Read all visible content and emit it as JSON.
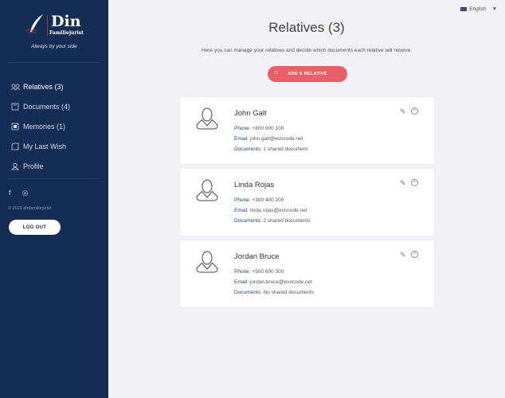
{
  "sidebar": {
    "logo": {
      "name": "Din",
      "subname": "Familiejurist"
    },
    "tagline": "Always by your side",
    "nav": [
      {
        "label": "Relatives (3)",
        "icon": "relatives-icon",
        "active": true
      },
      {
        "label": "Documents (4)",
        "icon": "documents-icon"
      },
      {
        "label": "Memories (1)",
        "icon": "memories-icon"
      },
      {
        "label": "My Last Wish",
        "icon": "last-wish-icon"
      },
      {
        "label": "Profile",
        "icon": "profile-icon"
      }
    ],
    "social": {
      "facebook": "f",
      "instagram": "◎"
    },
    "copyright": "© 2023 dinfamiliejurist",
    "logout": "LOG OUT"
  },
  "header": {
    "language": "English"
  },
  "main": {
    "title": "Relatives (3)",
    "intro": "Here you can manage your relatives and decide which documents each relative will receive.",
    "add_button": "ADD A RELATIVE",
    "labels": {
      "phone": "Phone:",
      "email": "Email:",
      "documents": "Documents:"
    },
    "relatives": [
      {
        "name": "John Galt",
        "phone": "+800 900 100",
        "email": "john.galt@evocode.net",
        "documents": "1 shared document"
      },
      {
        "name": "Linda Rojas",
        "phone": "+300 400 200",
        "email": "linda.rojas@evocode.net",
        "documents": "2 shared documents"
      },
      {
        "name": "Jordan Bruce",
        "phone": "+500 600 300",
        "email": "jordan.bruce@evocode.net",
        "documents": "No shared documents"
      }
    ]
  },
  "colors": {
    "sidebar": "#142d55",
    "accent": "#e85f68",
    "background": "#f1f1f6"
  }
}
